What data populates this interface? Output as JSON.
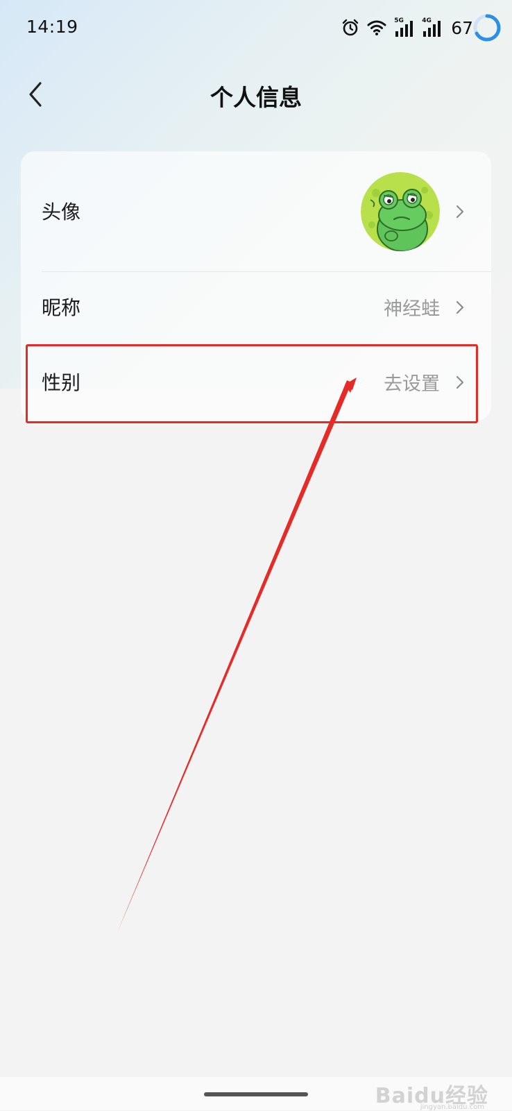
{
  "status_bar": {
    "time": "14:19",
    "battery": "67",
    "sig1_tag": "5G",
    "sig2_tag": "4G",
    "icons": [
      "alarm-icon",
      "wifi-icon",
      "signal-5g-icon",
      "signal-4g-icon",
      "battery-ring-icon"
    ]
  },
  "header": {
    "title": "个人信息",
    "back_icon": "chevron-left-icon"
  },
  "rows": [
    {
      "label": "头像",
      "value": "",
      "type": "avatar"
    },
    {
      "label": "昵称",
      "value": "神经蛙"
    },
    {
      "label": "性别",
      "value": "去设置"
    }
  ],
  "annotation": {
    "highlight_color": "#e52b27",
    "arrow_color": "#e52b27"
  },
  "watermark": {
    "text": "Baidu经验",
    "sub": "jingyan.baidu.com"
  },
  "colors": {
    "accent": "#2b8fe8",
    "value_gray": "#9a9a9a"
  }
}
